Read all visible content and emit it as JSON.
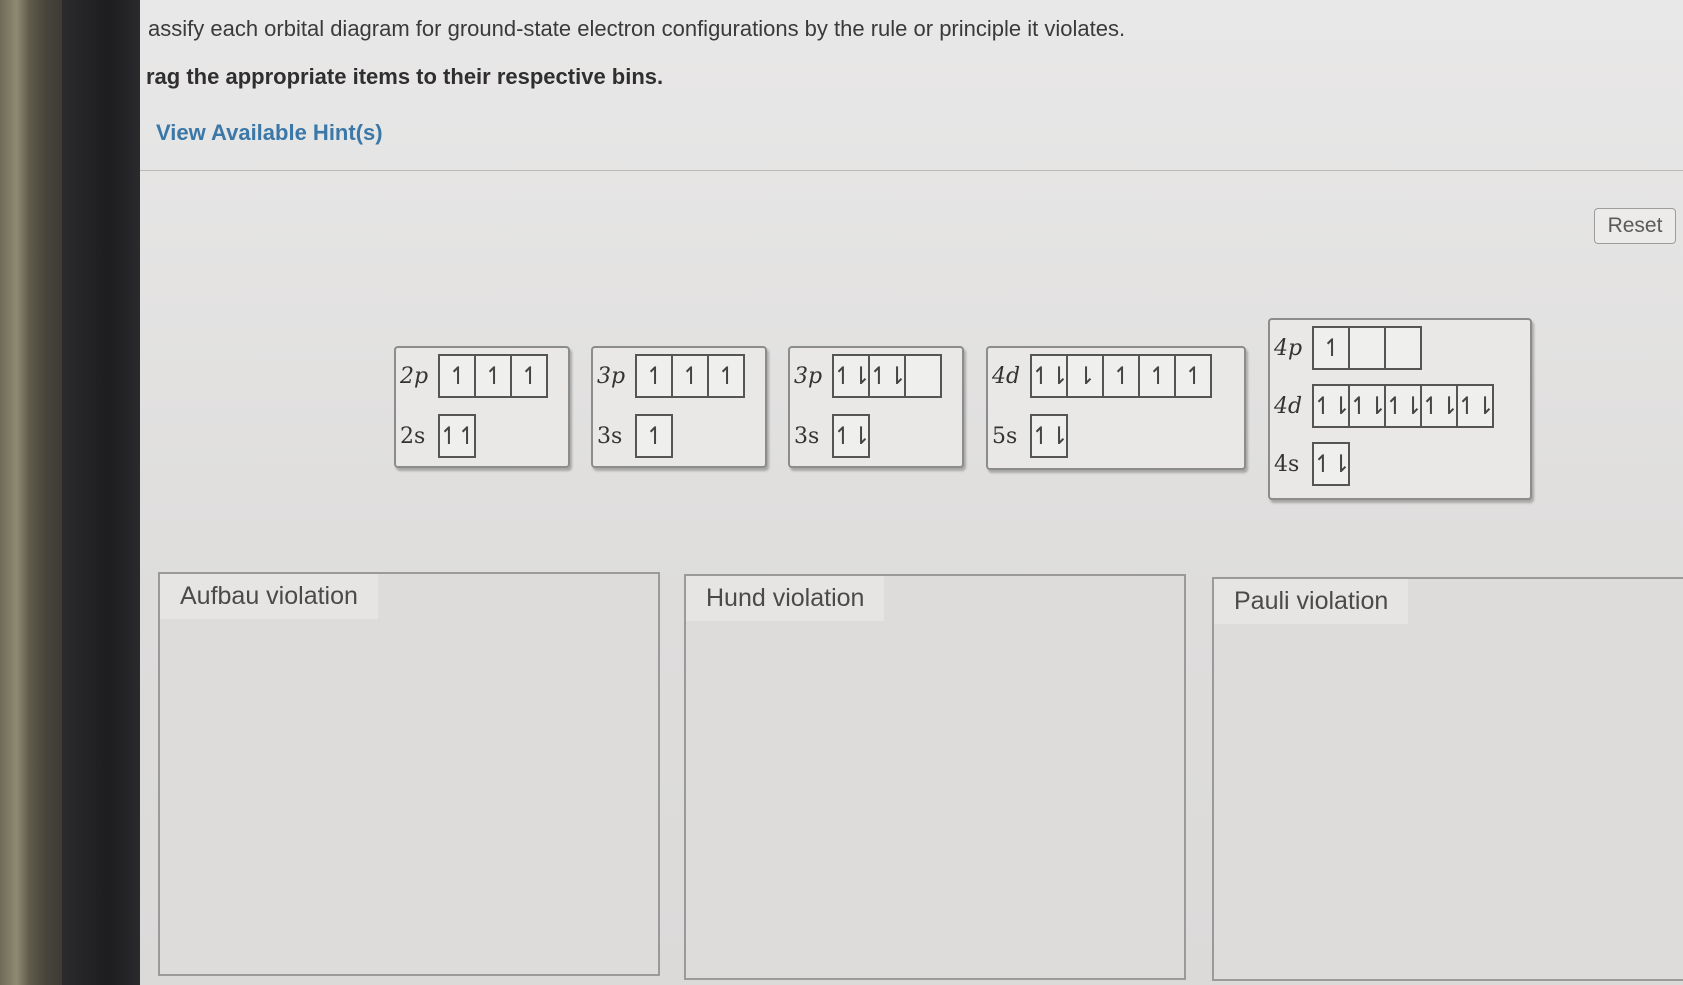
{
  "instructions": {
    "line1": "assify each orbital diagram for ground-state electron configurations by the rule or principle it violates.",
    "line2": "rag the appropriate items to their respective bins."
  },
  "hint_link": "View Available Hint(s)",
  "reset_label": "Reset",
  "cards": [
    {
      "rows": [
        {
          "label": "2p",
          "boxes": [
            "↿",
            "↿",
            "↿"
          ]
        },
        {
          "label": "2s",
          "boxes": [
            "↿↿"
          ]
        }
      ]
    },
    {
      "rows": [
        {
          "label": "3p",
          "boxes": [
            "↿",
            "↿",
            "↿"
          ]
        },
        {
          "label": "3s",
          "boxes": [
            "↿"
          ]
        }
      ]
    },
    {
      "rows": [
        {
          "label": "3p",
          "boxes": [
            "↿⇂",
            "↿⇂",
            ""
          ]
        },
        {
          "label": "3s",
          "boxes": [
            "↿⇂"
          ]
        }
      ]
    },
    {
      "rows": [
        {
          "label": "4d",
          "boxes": [
            "↿⇂",
            "⇂",
            "↿",
            "↿",
            "↿"
          ]
        },
        {
          "label": "5s",
          "boxes": [
            "↿⇂"
          ]
        }
      ]
    },
    {
      "rows": [
        {
          "label": "4p",
          "boxes": [
            "↿",
            "",
            ""
          ]
        },
        {
          "label": "4d",
          "boxes": [
            "↿⇂",
            "↿⇂",
            "↿⇂",
            "↿⇂",
            "↿⇂"
          ]
        },
        {
          "label": "4s",
          "boxes": [
            "↿⇂"
          ]
        }
      ]
    }
  ],
  "bins": [
    "Aufbau violation",
    "Hund violation",
    "Pauli violation"
  ]
}
